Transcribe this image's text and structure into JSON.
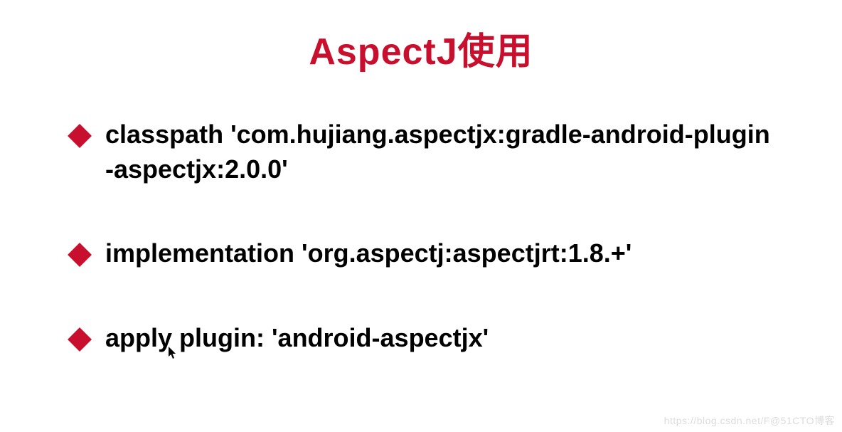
{
  "title": "AspectJ使用",
  "bullets": [
    {
      "text": "classpath 'com.hujiang.aspectjx:gradle-android-plugin-aspectjx:2.0.0'"
    },
    {
      "text": "implementation 'org.aspectj:aspectjrt:1.8.+'"
    },
    {
      "text": "apply plugin: 'android-aspectjx'"
    }
  ],
  "watermark": "https://blog.csdn.net/F@51CTO博客",
  "colors": {
    "accent": "#c8102e",
    "text": "#000000"
  }
}
